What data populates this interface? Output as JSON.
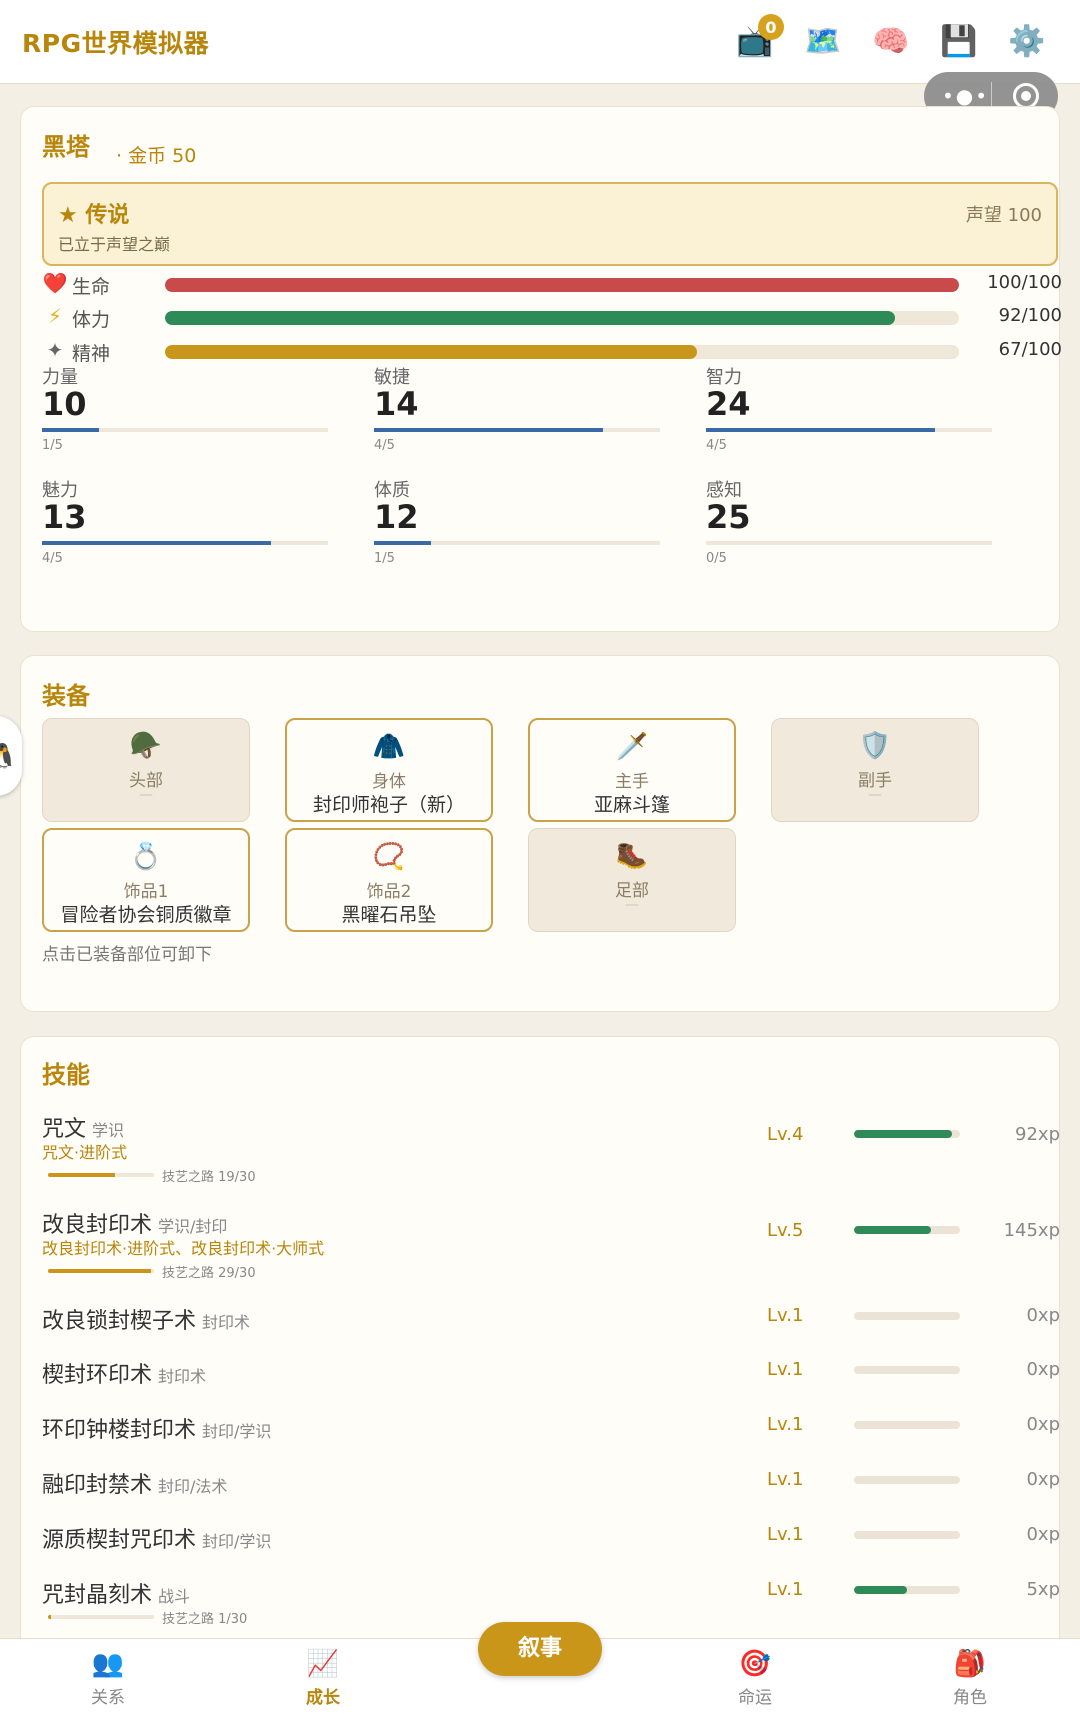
{
  "app": {
    "title": "RPG世界模拟器"
  },
  "top_icons": [
    {
      "name": "tv-icon",
      "glyph": "📺",
      "badge": "0"
    },
    {
      "name": "map-icon",
      "glyph": "🗺️"
    },
    {
      "name": "brain-icon",
      "glyph": "🧠"
    },
    {
      "name": "save-icon",
      "glyph": "💾"
    },
    {
      "name": "settings-gear-icon",
      "glyph": "⚙️"
    }
  ],
  "character": {
    "name": "黑塔",
    "gold": "· 金币 50",
    "rank": {
      "title": "★ 传说",
      "desc": "已立于声望之巅",
      "reputation": "声望 100"
    },
    "bars": [
      {
        "icon": "❤️",
        "label": "生命",
        "value": "100/100",
        "ratio": 1.0,
        "color": "#c94a4a"
      },
      {
        "icon": "⚡",
        "label": "体力",
        "value": "92/100",
        "ratio": 0.92,
        "color": "#2e8b57"
      },
      {
        "icon": "✦",
        "label": "精神",
        "value": "67/100",
        "ratio": 0.67,
        "color": "#c9961a"
      }
    ],
    "stats": [
      {
        "name": "力量",
        "value": "10",
        "progress": "1/5",
        "ratio": 0.2
      },
      {
        "name": "敏捷",
        "value": "14",
        "progress": "4/5",
        "ratio": 0.8
      },
      {
        "name": "智力",
        "value": "24",
        "progress": "4/5",
        "ratio": 0.8
      },
      {
        "name": "魅力",
        "value": "13",
        "progress": "4/5",
        "ratio": 0.8
      },
      {
        "name": "体质",
        "value": "12",
        "progress": "1/5",
        "ratio": 0.2
      },
      {
        "name": "感知",
        "value": "25",
        "progress": "0/5",
        "ratio": 0.0
      }
    ]
  },
  "equipment": {
    "title": "装备",
    "hint": "点击已装备部位可卸下",
    "slots": [
      {
        "icon": "🪖",
        "label": "头部",
        "item": "",
        "empty_mark": "—"
      },
      {
        "icon": "🧥",
        "label": "身体",
        "item": "封印师袍子（新）"
      },
      {
        "icon": "🗡️",
        "label": "主手",
        "item": "亚麻斗篷"
      },
      {
        "icon": "🛡️",
        "label": "副手",
        "item": "",
        "empty_mark": "—"
      },
      {
        "icon": "💍",
        "label": "饰品1",
        "item": "冒险者协会铜质徽章"
      },
      {
        "icon": "📿",
        "label": "饰品2",
        "item": "黑曜石吊坠"
      },
      {
        "icon": "🥾",
        "label": "足部",
        "item": "",
        "empty_mark": "—"
      }
    ]
  },
  "skills": {
    "title": "技能",
    "items": [
      {
        "name": "咒文",
        "tag": "学识",
        "advanced": "咒文·进阶式",
        "road": "技艺之路 19/30",
        "road_ratio": 0.633,
        "level": "Lv.4",
        "xp": "92xp",
        "xp_ratio": 0.92
      },
      {
        "name": "改良封印术",
        "tag": "学识/封印",
        "advanced": "改良封印术·进阶式、改良封印术·大师式",
        "road": "技艺之路 29/30",
        "road_ratio": 0.967,
        "level": "Lv.5",
        "xp": "145xp",
        "xp_ratio": 0.725
      },
      {
        "name": "改良锁封楔子术",
        "tag": "封印术",
        "level": "Lv.1",
        "xp": "0xp",
        "xp_ratio": 0.0
      },
      {
        "name": "楔封环印术",
        "tag": "封印术",
        "level": "Lv.1",
        "xp": "0xp",
        "xp_ratio": 0.0
      },
      {
        "name": "环印钟楼封印术",
        "tag": "封印/学识",
        "level": "Lv.1",
        "xp": "0xp",
        "xp_ratio": 0.0
      },
      {
        "name": "融印封禁术",
        "tag": "封印/法术",
        "level": "Lv.1",
        "xp": "0xp",
        "xp_ratio": 0.0
      },
      {
        "name": "源质楔封咒印术",
        "tag": "封印/学识",
        "level": "Lv.1",
        "xp": "0xp",
        "xp_ratio": 0.0
      },
      {
        "name": "咒封晶刻术",
        "tag": "战斗",
        "road": "技艺之路 1/30",
        "road_ratio": 0.033,
        "level": "Lv.1",
        "xp": "5xp",
        "xp_ratio": 0.5
      }
    ]
  },
  "story_button": "叙事",
  "bottom_nav": [
    {
      "icon": "👥",
      "label": "关系",
      "active": false
    },
    {
      "icon": "📈",
      "label": "成长",
      "active": true
    },
    {
      "icon": "🎯",
      "label": "命运",
      "active": false
    },
    {
      "icon": "🎒",
      "label": "角色",
      "active": false
    }
  ],
  "side_peek_icon": "🐧"
}
